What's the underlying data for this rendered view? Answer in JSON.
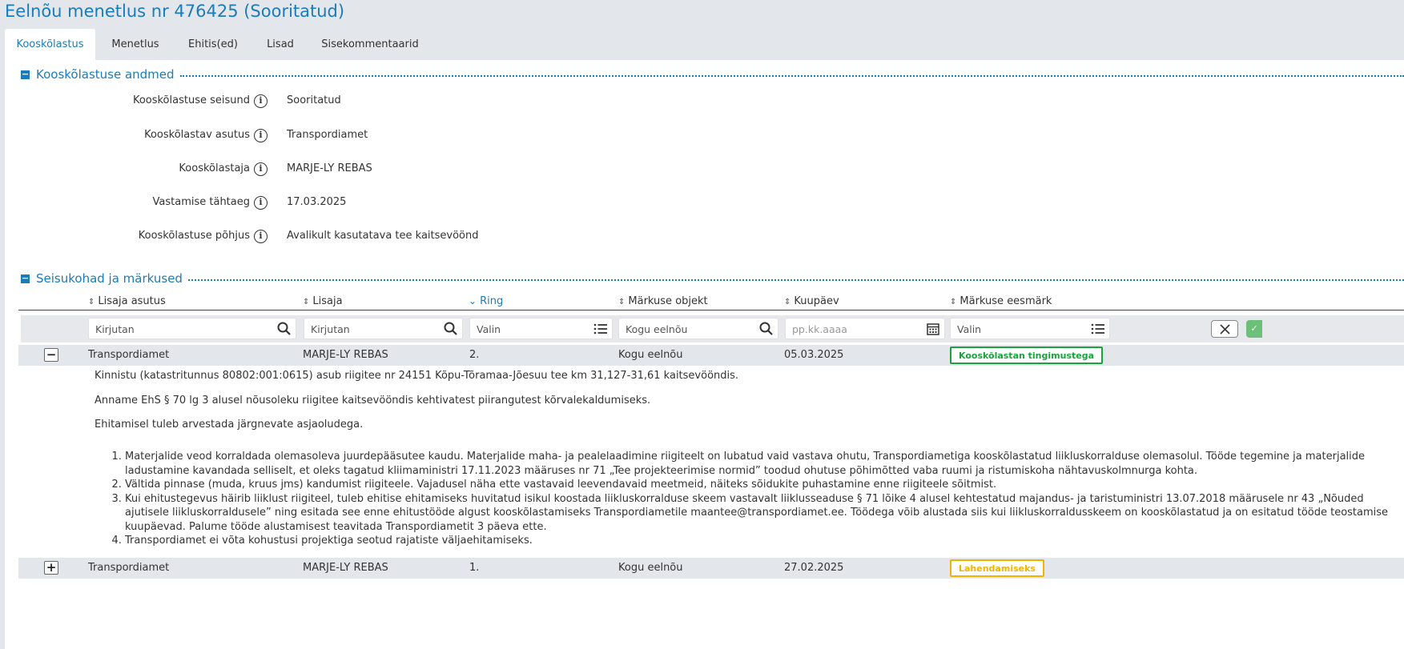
{
  "page_title": "Eelnõu menetlus nr 476425 (Sooritatud)",
  "tabs": [
    {
      "label": "Kooskõlastus",
      "active": true
    },
    {
      "label": "Menetlus"
    },
    {
      "label": "Ehitis(ed)"
    },
    {
      "label": "Lisad"
    },
    {
      "label": "Sisekommentaarid"
    }
  ],
  "section1": {
    "title": "Kooskõlastuse andmed",
    "fields": [
      {
        "label": "Kooskõlastuse seisund",
        "value": "Sooritatud"
      },
      {
        "label": "Kooskõlastav asutus",
        "value": "Transpordiamet"
      },
      {
        "label": "Kooskõlastaja",
        "value": "MARJE-LY REBAS"
      },
      {
        "label": "Vastamise tähtaeg",
        "value": "17.03.2025"
      },
      {
        "label": "Kooskõlastuse põhjus",
        "value": "Avalikult kasutatava tee kaitsevöönd"
      }
    ]
  },
  "section2": {
    "title": "Seisukohad ja märkused",
    "columns": [
      "Lisaja asutus",
      "Lisaja",
      "Ring",
      "Märkuse objekt",
      "Kuupäev",
      "Märkuse eesmärk"
    ],
    "active_sort_column": "Ring",
    "filters": {
      "lisaja_asutus": "Kirjutan",
      "lisaja": "Kirjutan",
      "ring": "Valin",
      "markuse_objekt": "Kogu eelnõu",
      "kuupaev": "pp.kk.aaaa",
      "eesmark": "Valin"
    },
    "rows": [
      {
        "toggle": "−",
        "asutus": "Transpordiamet",
        "lisaja": "MARJE-LY REBAS",
        "ring": "2.",
        "objekt": "Kogu eelnõu",
        "kuupaev": "05.03.2025",
        "eesmark": "Kooskõlastan tingimustega",
        "badge_color": "#1aa33a"
      },
      {
        "toggle": "+",
        "asutus": "Transpordiamet",
        "lisaja": "MARJE-LY REBAS",
        "ring": "1.",
        "objekt": "Kogu eelnõu",
        "kuupaev": "27.02.2025",
        "eesmark": "Lahendamiseks",
        "badge_color": "#f0b400"
      }
    ],
    "details": {
      "paragraphs": [
        "Kinnistu (katastritunnus 80802:001:0615) asub riigitee nr 24151 Kõpu-Tõramaa-Jõesuu tee km 31,127-31,61 kaitsevööndis.",
        "Anname EhS § 70 lg 3 alusel nõusoleku riigitee kaitsevööndis kehtivatest piirangutest kõrvalekaldumiseks.",
        "Ehitamisel tuleb arvestada järgnevate asjaoludega."
      ],
      "items": [
        "Materjalide veod korraldada olemasoleva juurdepääsutee kaudu. Materjalide maha- ja pealelaadimine riigiteelt on lubatud vaid vastava ohutu, Transpordiametiga kooskõlastatud liikluskorralduse olemasolul. Tööde tegemine ja materjalide ladustamine kavandada selliselt, et oleks tagatud kliimaministri 17.11.2023 määruses nr 71 „Tee projekteerimise normid” toodud ohutuse põhimõtted vaba ruumi ja ristumiskoha nähtavuskolmnurga kohta.",
        "Vältida pinnase (muda, kruus jms) kandumist riigiteele. Vajadusel näha ette vastavaid leevendavaid meetmeid, näiteks sõidukite puhastamine enne riigiteele sõitmist.",
        "Kui ehitustegevus häirib liiklust riigiteel, tuleb ehitise ehitamiseks huvitatud isikul koostada liikluskorralduse skeem vastavalt liiklusseaduse § 71 lõike 4 alusel kehtestatud majandus- ja taristuministri 13.07.2018 määrusele nr 43 „Nõuded ajutisele liikluskorraldusele” ning esitada see enne ehitustööde algust kooskõlastamiseks Transpordiametile maantee@transpordiamet.ee. Töödega võib alustada siis kui liikluskorraldusskeem on kooskõlastatud ja on esitatud tööde teostamise kuupäevad. Palume tööde alustamisest teavitada Transpordiametit 3 päeva ette.",
        "Transpordiamet ei võta kohustusi projektiga seotud rajatiste väljaehitamiseks."
      ]
    }
  }
}
